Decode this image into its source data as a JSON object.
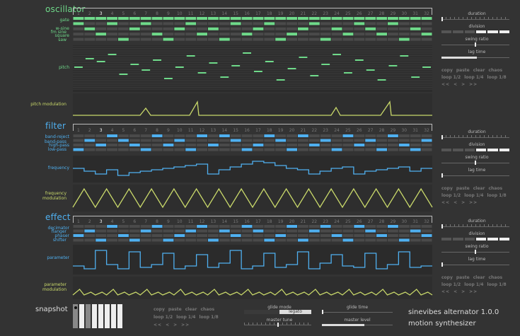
{
  "sections": {
    "oscillator": {
      "title": "oscillator",
      "rows": [
        "gate",
        "w-sine",
        "fm sine",
        "square",
        "saw"
      ],
      "lane1": "pitch",
      "lane2": "pitch modulation"
    },
    "filter": {
      "title": "filter",
      "rows": [
        "band-reject",
        "band-pass",
        "high-pass",
        "low-pass"
      ],
      "lane1": "frequency",
      "lane2": "frequency modulation"
    },
    "effect": {
      "title": "effect",
      "rows": [
        "decimator",
        "flanger",
        "phaser",
        "shifter"
      ],
      "lane1": "parameter",
      "lane2": "parameter modulation"
    }
  },
  "steps": [
    "1",
    "2",
    "3",
    "4",
    "5",
    "6",
    "7",
    "8",
    "9",
    "10",
    "11",
    "12",
    "13",
    "14",
    "15",
    "16",
    "17",
    "18",
    "19",
    "20",
    "21",
    "22",
    "23",
    "24",
    "25",
    "26",
    "27",
    "28",
    "29",
    "30",
    "31",
    "32"
  ],
  "current_step": 3,
  "controls": {
    "duration": "duration",
    "division": "division",
    "swing_ratio": "swing ratio",
    "lag_time": "lag time"
  },
  "buttons": {
    "copy": "copy",
    "paste": "paste",
    "clear": "clear",
    "chaos": "chaos",
    "loop_half": "loop 1/2",
    "loop_quarter": "loop 1/4",
    "loop_eighth": "loop 1/8",
    "nav_back_fast": "<<",
    "nav_back": "<",
    "nav_fwd": ">",
    "nav_fwd_fast": ">>"
  },
  "snapshot": {
    "title": "snapshot"
  },
  "global": {
    "glide_mode": "glide mode",
    "glide_mode_on": "legato",
    "glide_time": "glide time",
    "master_tune": "master tune",
    "master_level": "master level"
  },
  "app": {
    "name": "sinevibes alternator 1.0.0",
    "subtitle": "motion synthesizer"
  },
  "colors": {
    "osc_accent": "#6fda8a",
    "filter_accent": "#4fb0f0",
    "mod_line": "#c8d86a",
    "background": "#333333"
  }
}
